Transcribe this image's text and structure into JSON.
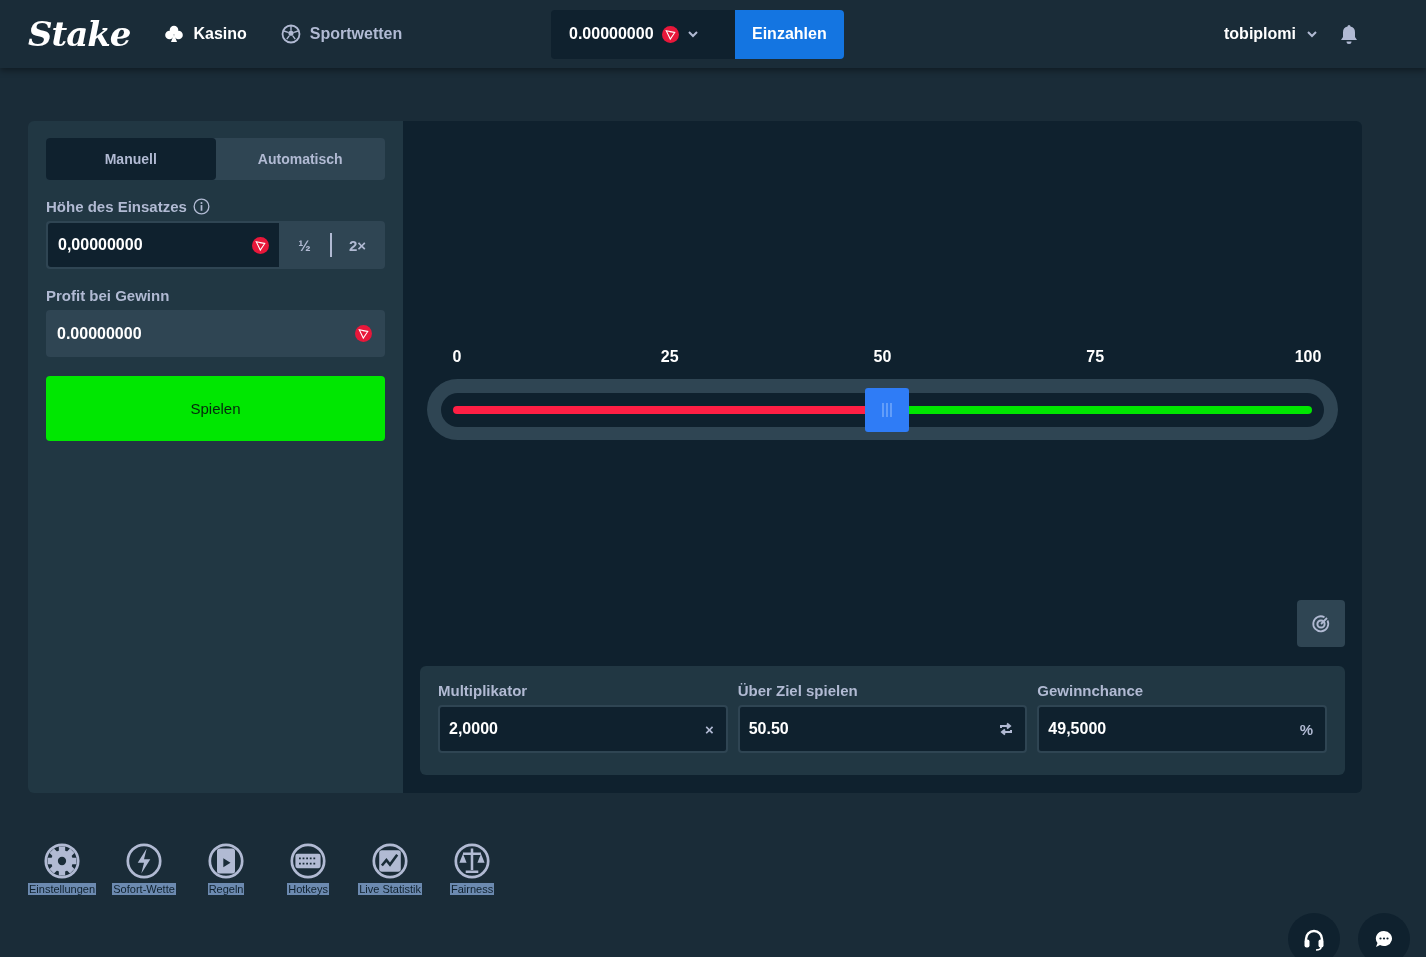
{
  "header": {
    "logo": "Stake",
    "nav": [
      {
        "label": "Kasino",
        "selected": true
      },
      {
        "label": "Sportwetten",
        "selected": false
      }
    ],
    "balance": "0.00000000",
    "deposit_button": "Einzahlen",
    "username": "tobiplomi"
  },
  "bet_panel": {
    "tabs": [
      {
        "label": "Manuell",
        "selected": true
      },
      {
        "label": "Automatisch",
        "selected": false
      }
    ],
    "bet_amount": {
      "label": "Höhe des Einsatzes",
      "value": "0,00000000",
      "half_button": "½",
      "double_button": "2×"
    },
    "profit": {
      "label": "Profit bei Gewinn",
      "value": "0.00000000"
    },
    "play_button": "Spielen"
  },
  "game": {
    "ticks": [
      "0",
      "25",
      "50",
      "75",
      "100"
    ],
    "slider": {
      "level": 0.505
    },
    "stats": [
      {
        "label": "Multiplikator",
        "value": "2,0000",
        "kind": "text",
        "suffix": "×"
      },
      {
        "label": "Über Ziel spielen",
        "value": "50.50",
        "kind": "swap"
      },
      {
        "label": "Gewinnchance",
        "value": "49,5000",
        "kind": "text",
        "suffix": "%"
      }
    ]
  },
  "footer": [
    {
      "label": "Einstellungen",
      "highlighted": true
    },
    {
      "label": "Sofort-Wette",
      "highlighted": true
    },
    {
      "label": "Regeln",
      "highlighted": true
    },
    {
      "label": "Hotkeys",
      "highlighted": true
    },
    {
      "label": "Live Statistik",
      "highlighted": true
    },
    {
      "label": "Fairness",
      "highlighted": true
    }
  ]
}
